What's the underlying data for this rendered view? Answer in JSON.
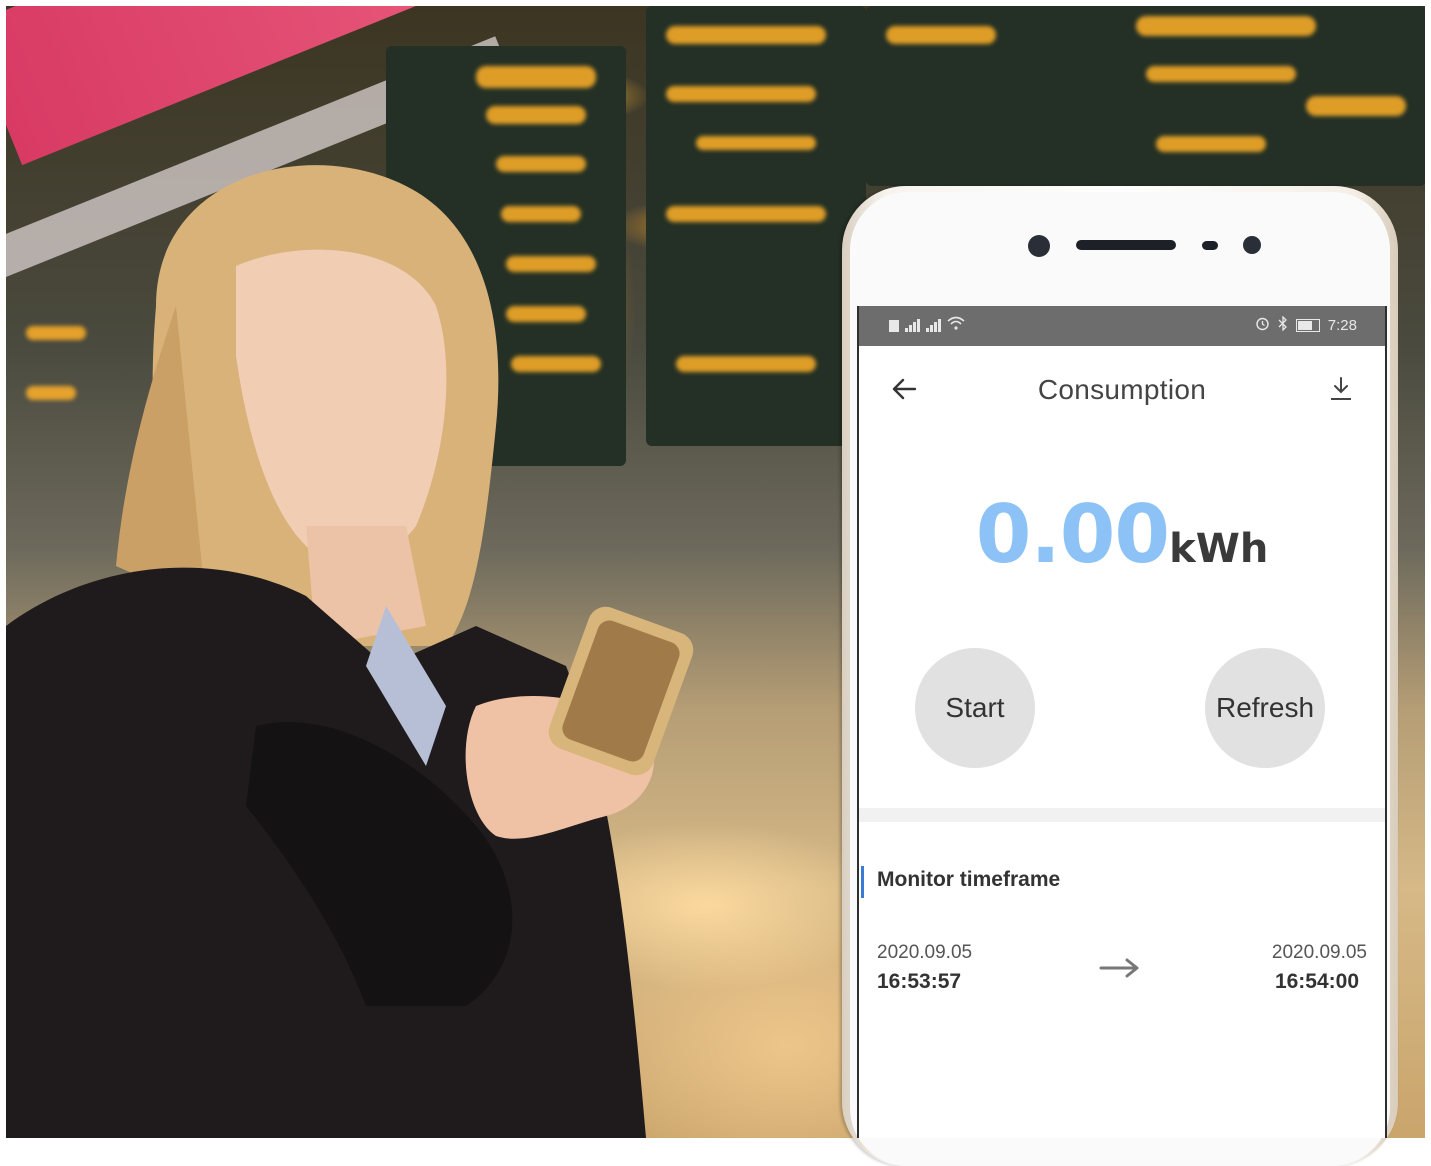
{
  "status_bar": {
    "time": "7:28"
  },
  "app_bar": {
    "title": "Consumption",
    "back_icon": "back-arrow-icon",
    "download_icon": "download-icon"
  },
  "reading": {
    "value": "0.00",
    "unit": "kWh"
  },
  "buttons": {
    "start_label": "Start",
    "refresh_label": "Refresh"
  },
  "timeframe": {
    "title": "Monitor timeframe",
    "start_date": "2020.09.05",
    "start_time": "16:53:57",
    "end_date": "2020.09.05",
    "end_time": "16:54:00"
  },
  "colors": {
    "value_accent": "#8cc2f5",
    "section_marker": "#3a7bd5",
    "button_bg": "#e1e1e1"
  }
}
